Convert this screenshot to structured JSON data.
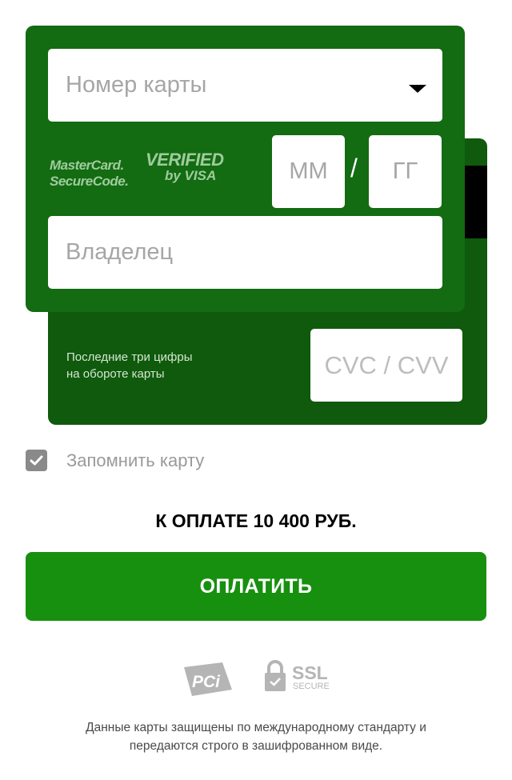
{
  "card_form": {
    "card_number_placeholder": "Номер карты",
    "month_placeholder": "ММ",
    "separator": "/",
    "year_placeholder": "ГГ",
    "holder_placeholder": "Владелец",
    "logos": {
      "mastercard_line1": "MasterCard.",
      "mastercard_line2": "SecureCode.",
      "visa_line1": "VERIFIED",
      "visa_line2": "by VISA"
    }
  },
  "card_back": {
    "cvc_hint_line1": "Последние три цифры",
    "cvc_hint_line2": "на обороте карты",
    "cvc_placeholder": "CVC / CVV"
  },
  "remember": {
    "label": "Запомнить карту",
    "checked": true
  },
  "payment": {
    "total_text": "К ОПЛАТЕ 10 400 РУБ.",
    "pay_button": "ОПЛАТИТЬ"
  },
  "security": {
    "pci_logo_text": "PCi",
    "ssl_logo_text": "SSL",
    "ssl_logo_sub": "SECURE",
    "note_line1": "Данные карты защищены по международному стандарту и",
    "note_line2": "передаются строго в зашифрованном виде."
  },
  "colors": {
    "card_front": "#136b12",
    "card_back": "#0f5a0c",
    "pay_button": "#17900f"
  }
}
